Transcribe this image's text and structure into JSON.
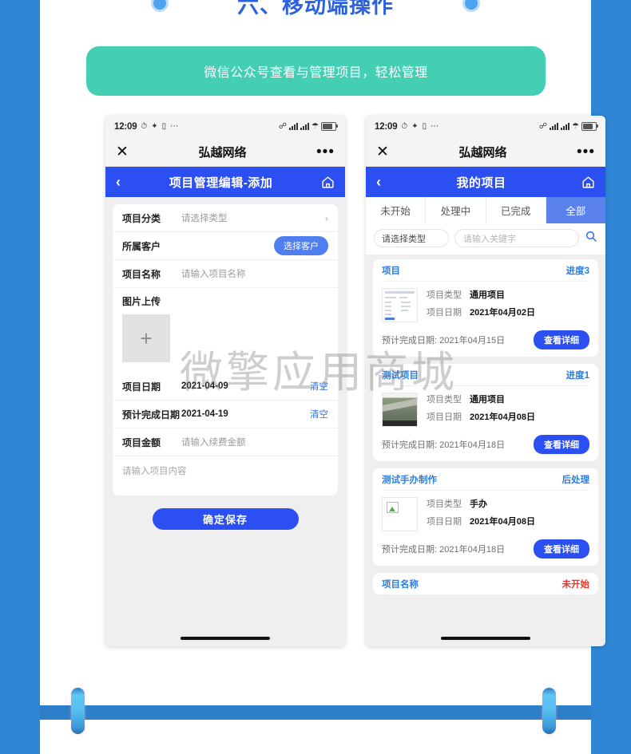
{
  "section": {
    "title": "六、移动端操作",
    "banner": "微信公众号查看与管理项目，轻松管理",
    "banner_color": "#44cfb4",
    "title_color": "#2b62e0"
  },
  "watermark": "微擎应用商城",
  "statusbar": {
    "time": "12:09",
    "icons_left": [
      "alarm-icon",
      "wechat-icon",
      "message-icon",
      "more-icon"
    ],
    "icons_right": [
      "bluetooth-icon",
      "signal-icon",
      "signal2-icon",
      "wifi-icon",
      "battery-icon"
    ],
    "battery_level": "85"
  },
  "wechat_bar": {
    "close": "✕",
    "title": "弘越网络",
    "more": "•••"
  },
  "phone_left": {
    "navbar": {
      "back": "‹",
      "title": "项目管理编辑-添加",
      "home_icon": "home-icon"
    },
    "form": {
      "rows": [
        {
          "label": "项目分类",
          "value": "请选择类型",
          "filled": false,
          "chevron": "›"
        },
        {
          "label": "所属客户",
          "value": "",
          "filled": false,
          "button": "选择客户"
        },
        {
          "label": "项目名称",
          "value": "请输入项目名称",
          "filled": false
        }
      ],
      "upload": {
        "label": "图片上传",
        "plus": "+"
      },
      "date_rows": [
        {
          "label": "项目日期",
          "value": "2021-04-09",
          "clear": "清空"
        },
        {
          "label": "预计完成日期",
          "value": "2021-04-19",
          "clear": "清空"
        }
      ],
      "amount_row": {
        "label": "项目金额",
        "value": "请输入续费金额"
      },
      "content_placeholder": "请输入项目内容",
      "save_button": "确定保存"
    }
  },
  "phone_right": {
    "navbar": {
      "back": "‹",
      "title": "我的项目",
      "home_icon": "home-icon"
    },
    "tabs": [
      {
        "label": "未开始",
        "active": false
      },
      {
        "label": "处理中",
        "active": false
      },
      {
        "label": "已完成",
        "active": false
      },
      {
        "label": "全部",
        "active": true
      }
    ],
    "filters": {
      "type_select": "请选择类型",
      "keyword_placeholder": "请输入关键字",
      "search_icon": "search-icon"
    },
    "field_labels": {
      "type": "项目类型",
      "date": "项目日期",
      "eta": "预计完成日期:"
    },
    "detail_button": "查看详细",
    "cards": [
      {
        "name": "项目",
        "stage": "进度3",
        "stage_warn": false,
        "type": "通用项目",
        "date": "2021年04月02日",
        "eta": "2021年04月15日",
        "thumb": "document-thumb"
      },
      {
        "name": "测试项目",
        "stage": "进度1",
        "stage_warn": false,
        "type": "通用项目",
        "date": "2021年04月08日",
        "eta": "2021年04月18日",
        "thumb": "photo-thumb"
      },
      {
        "name": "测试手办制作",
        "stage": "后处理",
        "stage_warn": false,
        "type": "手办",
        "date": "2021年04月08日",
        "eta": "2021年04月18日",
        "thumb": "broken-image-thumb"
      }
    ],
    "partial_card": {
      "name": "项目名称",
      "stage": "未开始",
      "stage_warn": true
    }
  },
  "colors": {
    "page_border": "#2e86d4",
    "nav_blue": "#2b4ff0",
    "tab_active": "#5b81ec",
    "link_blue": "#2b7de0",
    "warn_red": "#e8342a"
  }
}
